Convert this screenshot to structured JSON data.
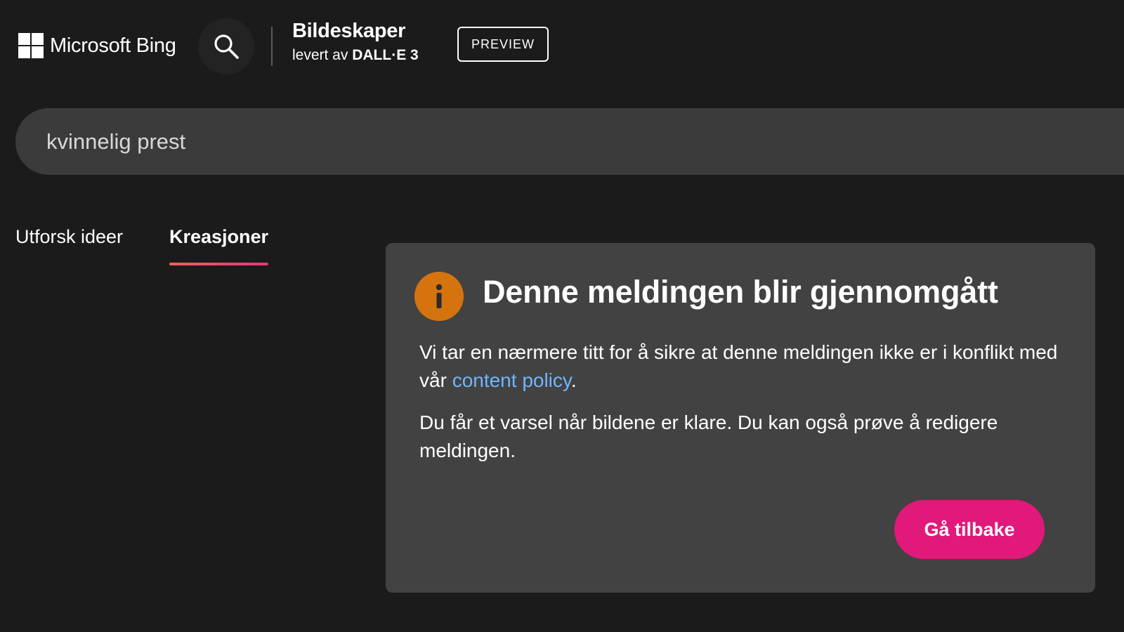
{
  "header": {
    "logo_text": "Microsoft Bing",
    "brand_title": "Bildeskaper",
    "brand_sub_prefix": "levert av",
    "brand_sub_model": "DALL·E 3",
    "preview_label": "PREVIEW"
  },
  "search": {
    "value": "kvinnelig prest"
  },
  "tabs": [
    {
      "label": "Utforsk ideer",
      "active": false
    },
    {
      "label": "Kreasjoner",
      "active": true
    }
  ],
  "notice": {
    "title": "Denne meldingen blir gjennomgått",
    "p1_before": "Vi tar en nærmere titt for å sikre at denne meldingen ikke er i konflikt med vår ",
    "p1_link": "content policy",
    "p1_after": ".",
    "p2": "Du får et varsel når bildene er klare. Du kan også prøve å redigere meldingen.",
    "back_label": "Gå tilbake"
  },
  "colors": {
    "background": "#1b1b1b",
    "search_bar": "#3b3b3b",
    "card": "#424242",
    "info_icon": "#d5730f",
    "link": "#6fb6ff",
    "back_button": "#e0197a"
  },
  "icons": {
    "logo": "microsoft-windows-grid-icon",
    "search": "search-icon",
    "info": "info-icon"
  }
}
